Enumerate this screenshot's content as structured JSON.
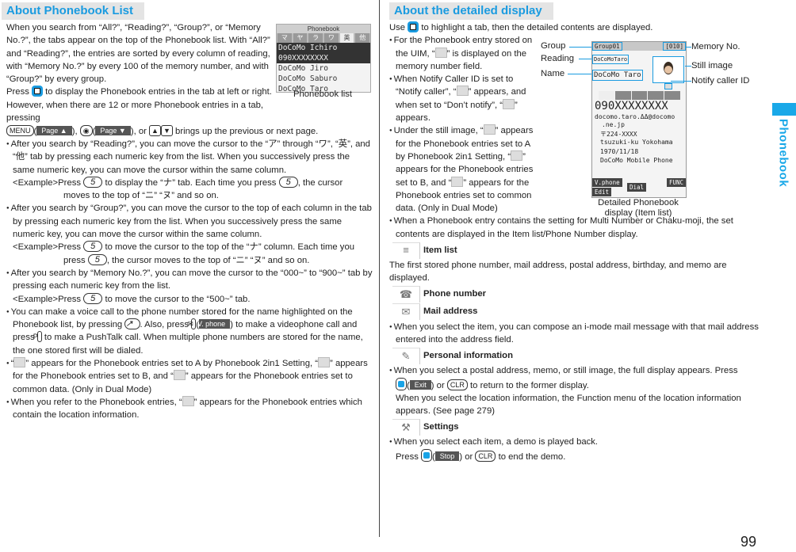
{
  "left": {
    "title": "About Phonebook List",
    "intro": "When you search from “All?”, “Reading?”, “Group?”, or “Memory No.?”, the tabs appear on the top of the Phonebook list. With “All?” and “Reading?”, the entries are sorted by every column of reading, with “Memory No.?” by every 100 of the memory number, and with “Group?” by every group.",
    "press_a": "Press",
    "press_b": "to display the Phonebook entries in the tab at left or right. However, when there are 12 or more Phonebook entries in a tab, pressing",
    "page_up": "Page ▲",
    "page_down": "Page ▼",
    "press_c": ", or",
    "press_d": "brings up the previous or next page.",
    "bullet1_a": "After you search by “Reading?”, you can move the cursor to the “ア” through “ワ”, “英”, and “他” tab by pressing each numeric key from the list. When you successively press the same numeric key, you can move the cursor within the same column.",
    "bullet1_ex_a": "<Example>Press",
    "bullet1_ex_b": "to display the “ナ” tab. Each time you press",
    "bullet1_ex_c": ", the cursor",
    "bullet1_ex_d": "moves to the top of “ニ” “ヌ” and so on.",
    "bullet2_a": "After you search by “Group?”, you can move the cursor to the top of each column in the tab by pressing each numeric key from the list. When you successively press the same numeric key, you can move the cursor within the same column.",
    "bullet2_ex_a": "<Example>Press",
    "bullet2_ex_b": "to move the cursor to the top of the “ナ” column. Each time you",
    "bullet2_ex_c": "press",
    "bullet2_ex_d": ", the cursor moves to the top of “ニ” “ヌ” and so on.",
    "bullet3_a": "After you search by “Memory No.?”, you can move the cursor to the “000~” to “900~” tab by pressing each numeric key from the list.",
    "bullet3_ex_a": "<Example>Press",
    "bullet3_ex_b": "to move the cursor to the “500~” tab.",
    "bullet4_a": "You can make a voice call to the phone number stored for the name highlighted on the Phonebook list, by pressing",
    "bullet4_b": ". Also, press",
    "bullet4_vphone": "V. phone",
    "bullet4_c": ") to make a videophone call and press",
    "bullet4_d": "to make a PushTalk call. When multiple phone numbers are stored for the name, the one stored first will be dialed.",
    "bullet5_a": "“",
    "bullet5_b": "” appears for the Phonebook entries set to A by Phonebook 2in1 Setting, “",
    "bullet5_c": "” appears for the Phonebook entries set to B, and “",
    "bullet5_d": "” appears for the Phonebook entries set to common data. (Only in Dual Mode)",
    "bullet6_a": "When you refer to the Phonebook entries, “",
    "bullet6_b": "” appears for the Phonebook entries which contain the location information.",
    "key5": "5",
    "menu_key": "MENU",
    "phone_list": {
      "title": "Phonebook",
      "tabs": [
        "マ",
        "ヤ",
        "ラ",
        "ワ",
        "英",
        "他"
      ],
      "rows": [
        "DoCoMo Ichiro",
        "090XXXXXXXX",
        "DoCoMo Jiro",
        "DoCoMo Saburo",
        "DoCoMo Taro"
      ],
      "caption": "Phonebook list"
    }
  },
  "right": {
    "title": "About the detailed display",
    "use_a": "Use",
    "use_b": "to highlight a tab, then the detailed contents are displayed.",
    "b1_a": "For the Phonebook entry stored on the UIM, “",
    "b1_b": "” is displayed on the memory number field.",
    "b2_a": "When Notify Caller ID is set to “Notify caller”, “",
    "b2_b": "” appears, and when set to “Don’t notify”, “",
    "b2_c": "” appears.",
    "b3_a": "Under the still image, “",
    "b3_b": "” appears for the Phonebook entries set to A by Phonebook 2in1 Setting, “",
    "b3_c": "” appears for the Phonebook entries set to B, and “",
    "b3_d": "” appears for the Phonebook entries set to common data. (Only in Dual Mode)",
    "b4": "When a Phonebook entry contains the setting for Multi Number or Chaku-moji, the set contents are displayed in the Item list/Phone Number display.",
    "items": [
      {
        "icon": "item-list-icon",
        "glyph": "≡",
        "title": "Item list"
      },
      {
        "icon": "phone-icon",
        "glyph": "☎",
        "title": "Phone number"
      },
      {
        "icon": "mail-icon",
        "glyph": "✉",
        "title": "Mail address"
      },
      {
        "icon": "personal-info-icon",
        "glyph": "✎",
        "title": "Personal information"
      },
      {
        "icon": "settings-icon",
        "glyph": "⚒",
        "title": "Settings"
      }
    ],
    "item_list_desc": "The first stored phone number, mail address, postal address, birthday, and memo are displayed.",
    "mail_desc": "When you select the item, you can compose an i-mode mail message with that mail address entered into the address field.",
    "personal_a": "When you select a postal address, memo, or still image, the full display appears. Press",
    "personal_exit": "Exit",
    "personal_or": ") or",
    "clr": "CLR",
    "personal_b": "to return to the former display.",
    "personal_c": "When you select the location information, the Function menu of the location information appears. (See page 279)",
    "settings_a": "When you select each item, a demo is played back.",
    "settings_press": "Press",
    "settings_stop": "Stop",
    "settings_b": "to end the demo.",
    "detail": {
      "group": "Group01",
      "memno": "[010]",
      "reading": "DoCoMoTaro",
      "name": "DoCoMo Taro",
      "phone": "090XXXXXXXX",
      "mail1": "docomo.taro.ΔΔ@docomo",
      "mail2": ".ne.jp",
      "zip": "〒224-XXXX",
      "addr": "tsuzuki-ku Yokohama",
      "birthday": "1970/11/18",
      "memo": "DoCoMo Mobile Phone",
      "soft_vphone": "V.phone",
      "soft_edit": "Edit",
      "soft_dial": "Dial",
      "soft_func": "FUNC",
      "caption": "Detailed Phonebook display (Item list)"
    },
    "labels": {
      "group": "Group",
      "reading": "Reading",
      "name": "Name",
      "memno": "Memory No.",
      "still": "Still image",
      "notify": "Notify caller ID"
    }
  },
  "side_tab": "Phonebook",
  "page_number": "99"
}
